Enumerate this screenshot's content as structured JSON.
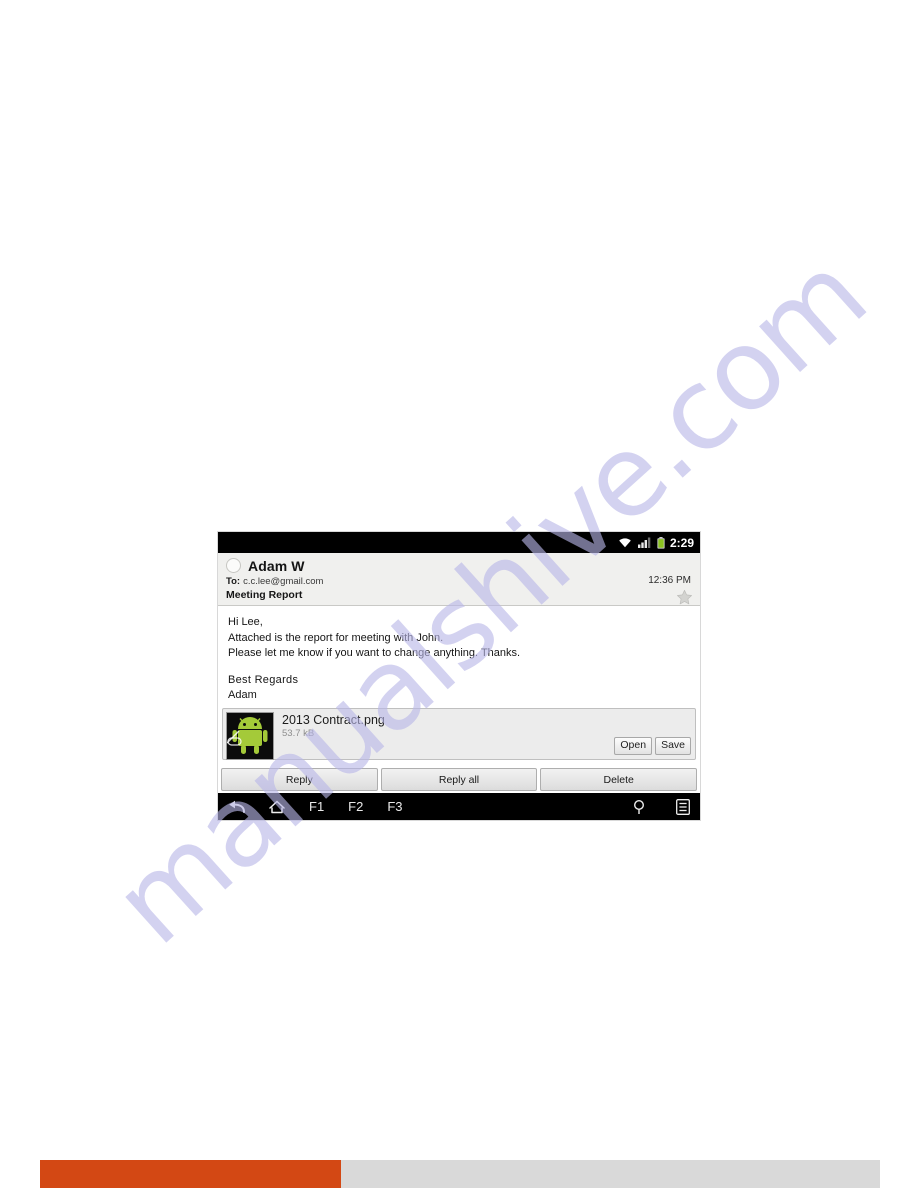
{
  "page": {
    "watermark_text": "manualshive.com",
    "watermark_color": "#b9b7e8",
    "footer_accent_color": "#d34814",
    "footer_secondary_color": "#d9d9d9"
  },
  "device": {
    "statusbar": {
      "time": "2:29",
      "icons": [
        "wifi-icon",
        "cellular-signal-icon",
        "battery-icon"
      ]
    },
    "mail": {
      "sender_name": "Adam W",
      "to_label": "To:",
      "to_value": "c.c.lee@gmail.com",
      "subject": "Meeting Report",
      "time": "12:36 PM",
      "star_icon": "star-icon",
      "avatar_icon": "contact-avatar-icon",
      "body_lines": [
        "Hi Lee,",
        "Attached is the report for meeting with John.",
        "Please let me know if you want to change anything. Thanks."
      ],
      "signature_line": "Best Regards",
      "signature_name": "Adam"
    },
    "attachment": {
      "filename": "2013 Contract.png",
      "filesize": "53.7 kB",
      "thumbnail_icon": "android-robot-thumbnail",
      "open_label": "Open",
      "save_label": "Save"
    },
    "actions": {
      "reply_label": "Reply",
      "reply_all_label": "Reply all",
      "delete_label": "Delete"
    },
    "navbar": {
      "back_icon": "back-arrow-icon",
      "home_icon": "home-icon",
      "f1_label": "F1",
      "f2_label": "F2",
      "f3_label": "F3",
      "search_icon": "search-icon",
      "menu_icon": "menu-icon"
    }
  }
}
